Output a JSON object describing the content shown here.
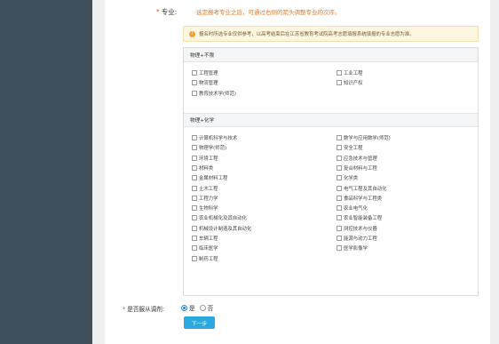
{
  "colors": {
    "sidebar": "#3f4f5c",
    "accent": "#2ba8e0",
    "required": "#e0503a",
    "hint": "#e07a30",
    "notice_bg": "#fff6e0"
  },
  "form": {
    "major_label": "专业:",
    "required_mark": "*",
    "major_hint": "选定报考专业之后，可通过右侧的箭头调整专业的次序。",
    "notice_icon": "info-icon",
    "notice_text": "报名时所选专业仅供参考，以高考结束后在江苏省教育考试院高考志愿填报系统填报的专业志愿为准。",
    "groups": [
      {
        "title": "物理+不限",
        "options": [
          "工程管理",
          "工业工程",
          "物流管理",
          "知识产权",
          "教育技术学(师范)"
        ]
      },
      {
        "title": "物理+化学",
        "options": [
          "计算机科学与技术",
          "数学与应用数学(师范)",
          "物理学(师范)",
          "安全工程",
          "环境工程",
          "应急技术与管理",
          "材料类",
          "复合材料与工程",
          "金属材料工程",
          "化学类",
          "土木工程",
          "电气工程及其自动化",
          "工程力学",
          "食品科学与工程类",
          "生物科学",
          "农业电气化",
          "农业机械化及其自动化",
          "农业智能装备工程",
          "机械设计制造及其自动化",
          "测控技术与仪器",
          "车辆工程",
          "能源与动力工程",
          "临床医学",
          "医学影像学",
          "制药工程"
        ]
      }
    ],
    "adjust_label": "是否服从调剂:",
    "adjust_options": [
      {
        "label": "是",
        "checked": true
      },
      {
        "label": "否",
        "checked": false
      }
    ],
    "next_button": "下一步"
  }
}
